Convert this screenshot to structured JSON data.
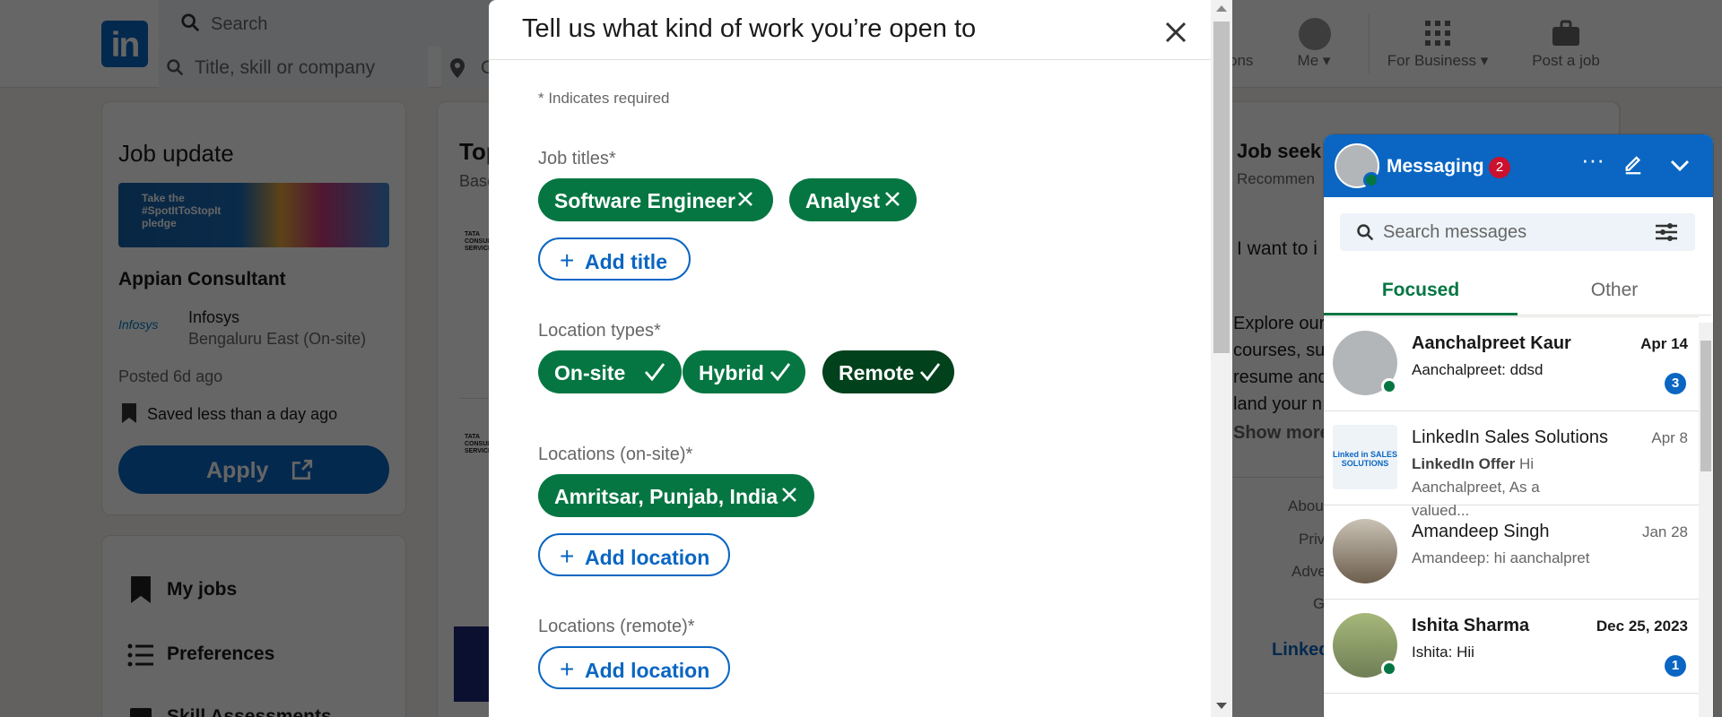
{
  "header": {
    "search_placeholder": "Search",
    "title_placeholder": "Title, skill or company",
    "location_placeholder": "C",
    "nav_fragment": "ons",
    "me_label": "Me",
    "business_label": "For Business",
    "post_job_label": "Post a job"
  },
  "left": {
    "job_update_title": "Job update",
    "banner_text": "Take the #SpotItToStopIt pledge",
    "job_title": "Appian Consultant",
    "company": "Infosys",
    "company_logo_text": "Infosys",
    "location": "Bengaluru East (On-site)",
    "posted": "Posted 6d ago",
    "saved": "Saved less than a day ago",
    "apply_label": "Apply",
    "menu": [
      "My jobs",
      "Preferences",
      "Skill Assessments"
    ]
  },
  "middle": {
    "heading_fragment": "Top",
    "sub_fragment": "Base",
    "company_logo_fragment": "TATA CONSULTANCY SERVICES"
  },
  "right": {
    "heading_fragment": "Job seek",
    "sub_fragment": "Recommen",
    "want_fragment": "I want to i",
    "explore_lines": [
      "Explore our",
      "courses, su",
      "resume and",
      "land your n"
    ],
    "show_more": "Show more",
    "footer_links": [
      "About",
      "Priv",
      "Adve",
      "G"
    ],
    "linkedin_fragment": "Linked"
  },
  "messaging": {
    "title": "Messaging",
    "unread": "2",
    "search_placeholder": "Search messages",
    "tabs": [
      "Focused",
      "Other"
    ],
    "conversations": [
      {
        "name": "Aanchalpreet Kaur",
        "date": "Apr 14",
        "preview": "Aanchalpreet: ddsd",
        "count": "3"
      },
      {
        "name": "LinkedIn Sales Solutions",
        "date": "Apr 8",
        "preview_bold": "LinkedIn Offer",
        "preview": "Hi Aanchalpreet, As a valued...",
        "logo_text": "Linked in SALES SOLUTIONS"
      },
      {
        "name": "Amandeep Singh",
        "date": "Jan 28",
        "preview": "Amandeep: hi aanchalpret"
      },
      {
        "name": "Ishita Sharma",
        "date": "Dec 25, 2023",
        "preview": "Ishita: Hii",
        "count": "1"
      }
    ]
  },
  "modal": {
    "title": "Tell us what kind of work you’re open to",
    "required_note": "* Indicates required",
    "job_titles_label": "Job titles*",
    "job_titles": [
      "Software Engineer",
      "Analyst"
    ],
    "add_title": "Add title",
    "location_types_label": "Location types*",
    "location_types": [
      {
        "label": "On-site",
        "selected": true
      },
      {
        "label": "Hybrid",
        "selected": true
      },
      {
        "label": "Remote",
        "selected": true
      }
    ],
    "onsite_label": "Locations (on-site)*",
    "onsite_locations": [
      "Amritsar, Punjab, India"
    ],
    "add_location": "Add location",
    "remote_label": "Locations (remote)*"
  },
  "colors": {
    "brand_blue": "#0a66c2",
    "green": "#057642",
    "dark_green": "#01411c",
    "badge_red": "#cb112d"
  }
}
